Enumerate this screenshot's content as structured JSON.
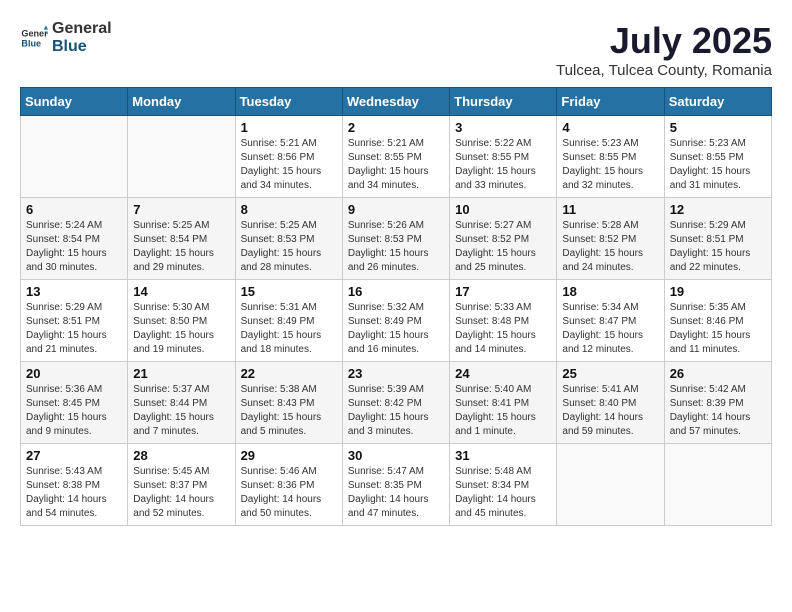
{
  "header": {
    "logo_general": "General",
    "logo_blue": "Blue",
    "month": "July 2025",
    "location": "Tulcea, Tulcea County, Romania"
  },
  "days_of_week": [
    "Sunday",
    "Monday",
    "Tuesday",
    "Wednesday",
    "Thursday",
    "Friday",
    "Saturday"
  ],
  "weeks": [
    [
      {
        "day": "",
        "info": ""
      },
      {
        "day": "",
        "info": ""
      },
      {
        "day": "1",
        "info": "Sunrise: 5:21 AM\nSunset: 8:56 PM\nDaylight: 15 hours and 34 minutes."
      },
      {
        "day": "2",
        "info": "Sunrise: 5:21 AM\nSunset: 8:55 PM\nDaylight: 15 hours and 34 minutes."
      },
      {
        "day": "3",
        "info": "Sunrise: 5:22 AM\nSunset: 8:55 PM\nDaylight: 15 hours and 33 minutes."
      },
      {
        "day": "4",
        "info": "Sunrise: 5:23 AM\nSunset: 8:55 PM\nDaylight: 15 hours and 32 minutes."
      },
      {
        "day": "5",
        "info": "Sunrise: 5:23 AM\nSunset: 8:55 PM\nDaylight: 15 hours and 31 minutes."
      }
    ],
    [
      {
        "day": "6",
        "info": "Sunrise: 5:24 AM\nSunset: 8:54 PM\nDaylight: 15 hours and 30 minutes."
      },
      {
        "day": "7",
        "info": "Sunrise: 5:25 AM\nSunset: 8:54 PM\nDaylight: 15 hours and 29 minutes."
      },
      {
        "day": "8",
        "info": "Sunrise: 5:25 AM\nSunset: 8:53 PM\nDaylight: 15 hours and 28 minutes."
      },
      {
        "day": "9",
        "info": "Sunrise: 5:26 AM\nSunset: 8:53 PM\nDaylight: 15 hours and 26 minutes."
      },
      {
        "day": "10",
        "info": "Sunrise: 5:27 AM\nSunset: 8:52 PM\nDaylight: 15 hours and 25 minutes."
      },
      {
        "day": "11",
        "info": "Sunrise: 5:28 AM\nSunset: 8:52 PM\nDaylight: 15 hours and 24 minutes."
      },
      {
        "day": "12",
        "info": "Sunrise: 5:29 AM\nSunset: 8:51 PM\nDaylight: 15 hours and 22 minutes."
      }
    ],
    [
      {
        "day": "13",
        "info": "Sunrise: 5:29 AM\nSunset: 8:51 PM\nDaylight: 15 hours and 21 minutes."
      },
      {
        "day": "14",
        "info": "Sunrise: 5:30 AM\nSunset: 8:50 PM\nDaylight: 15 hours and 19 minutes."
      },
      {
        "day": "15",
        "info": "Sunrise: 5:31 AM\nSunset: 8:49 PM\nDaylight: 15 hours and 18 minutes."
      },
      {
        "day": "16",
        "info": "Sunrise: 5:32 AM\nSunset: 8:49 PM\nDaylight: 15 hours and 16 minutes."
      },
      {
        "day": "17",
        "info": "Sunrise: 5:33 AM\nSunset: 8:48 PM\nDaylight: 15 hours and 14 minutes."
      },
      {
        "day": "18",
        "info": "Sunrise: 5:34 AM\nSunset: 8:47 PM\nDaylight: 15 hours and 12 minutes."
      },
      {
        "day": "19",
        "info": "Sunrise: 5:35 AM\nSunset: 8:46 PM\nDaylight: 15 hours and 11 minutes."
      }
    ],
    [
      {
        "day": "20",
        "info": "Sunrise: 5:36 AM\nSunset: 8:45 PM\nDaylight: 15 hours and 9 minutes."
      },
      {
        "day": "21",
        "info": "Sunrise: 5:37 AM\nSunset: 8:44 PM\nDaylight: 15 hours and 7 minutes."
      },
      {
        "day": "22",
        "info": "Sunrise: 5:38 AM\nSunset: 8:43 PM\nDaylight: 15 hours and 5 minutes."
      },
      {
        "day": "23",
        "info": "Sunrise: 5:39 AM\nSunset: 8:42 PM\nDaylight: 15 hours and 3 minutes."
      },
      {
        "day": "24",
        "info": "Sunrise: 5:40 AM\nSunset: 8:41 PM\nDaylight: 15 hours and 1 minute."
      },
      {
        "day": "25",
        "info": "Sunrise: 5:41 AM\nSunset: 8:40 PM\nDaylight: 14 hours and 59 minutes."
      },
      {
        "day": "26",
        "info": "Sunrise: 5:42 AM\nSunset: 8:39 PM\nDaylight: 14 hours and 57 minutes."
      }
    ],
    [
      {
        "day": "27",
        "info": "Sunrise: 5:43 AM\nSunset: 8:38 PM\nDaylight: 14 hours and 54 minutes."
      },
      {
        "day": "28",
        "info": "Sunrise: 5:45 AM\nSunset: 8:37 PM\nDaylight: 14 hours and 52 minutes."
      },
      {
        "day": "29",
        "info": "Sunrise: 5:46 AM\nSunset: 8:36 PM\nDaylight: 14 hours and 50 minutes."
      },
      {
        "day": "30",
        "info": "Sunrise: 5:47 AM\nSunset: 8:35 PM\nDaylight: 14 hours and 47 minutes."
      },
      {
        "day": "31",
        "info": "Sunrise: 5:48 AM\nSunset: 8:34 PM\nDaylight: 14 hours and 45 minutes."
      },
      {
        "day": "",
        "info": ""
      },
      {
        "day": "",
        "info": ""
      }
    ]
  ]
}
